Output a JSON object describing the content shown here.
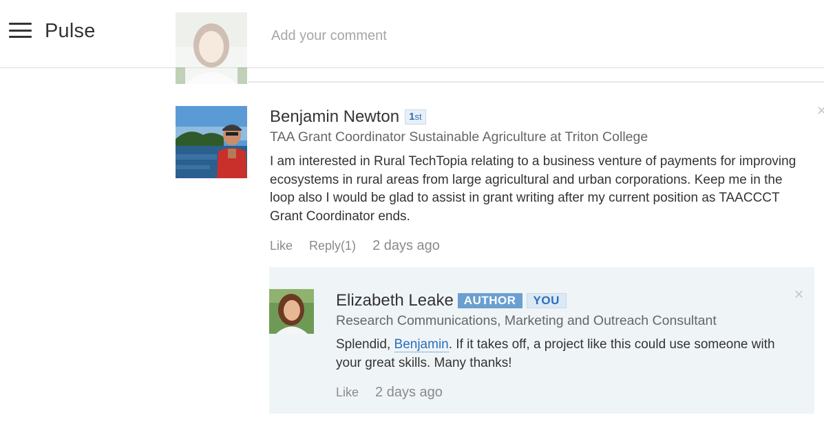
{
  "header": {
    "menu_icon": "hamburger-menu-icon",
    "title": "Pulse"
  },
  "composer": {
    "placeholder": "Add your comment"
  },
  "comment": {
    "author": "Benjamin Newton",
    "degree_number": "1",
    "degree_suffix": "st",
    "headline": "TAA Grant Coordinator Sustainable Agriculture at Triton College",
    "text": "I am interested in Rural TechTopia relating to a business venture of payments for improving ecosystems in rural areas from large agricultural and urban corporations. Keep me in the loop also I would be glad to assist in grant writing after my current position as TAACCCT Grant Coordinator ends.",
    "like_label": "Like",
    "reply_label": "Reply(1)",
    "timestamp": "2 days ago"
  },
  "reply": {
    "author": "Elizabeth Leake",
    "badge_author": "AUTHOR",
    "badge_you": "YOU",
    "headline": "Research Communications, Marketing and Outreach Consultant",
    "text_before": "Splendid, ",
    "mention": "Benjamin",
    "text_after": ". If it takes off, a project like this could use someone with your great skills. Many thanks!",
    "like_label": "Like",
    "timestamp": "2 days ago"
  },
  "colors": {
    "link_blue": "#2a6ebb",
    "author_badge": "#6a9fd0",
    "reply_background": "#eff4f7"
  }
}
